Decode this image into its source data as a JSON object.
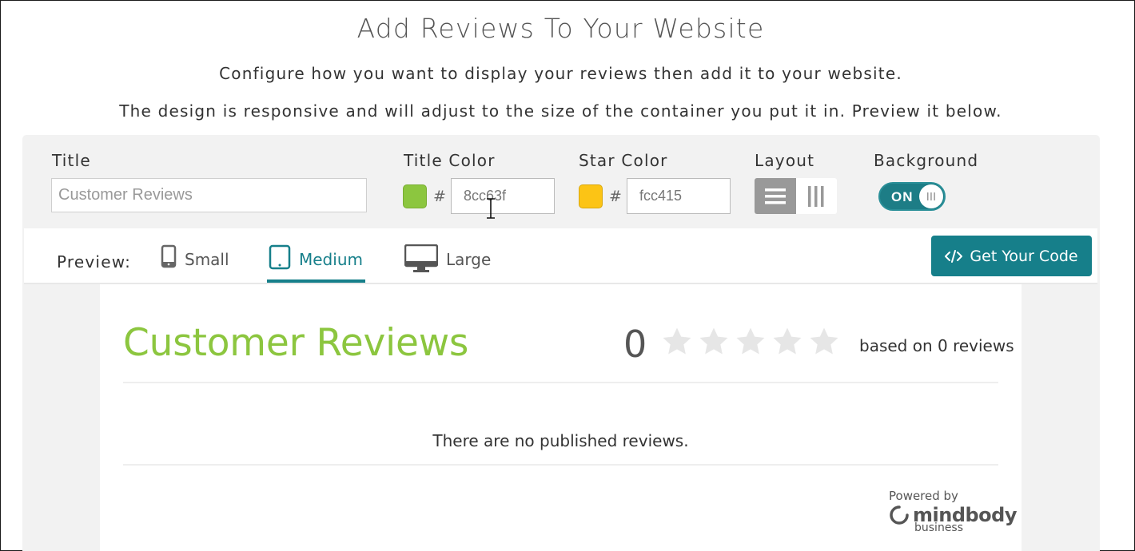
{
  "header": {
    "title": "Add Reviews To Your Website",
    "subtitle_1": "Configure how you want to display your reviews then add it to your website.",
    "subtitle_2": "The design is responsive and will adjust to the size of the container you put it in. Preview it below."
  },
  "config": {
    "title_label": "Title",
    "title_placeholder": "Customer Reviews",
    "title_color_label": "Title Color",
    "title_color_hash": "#",
    "title_color_value": "8cc63f",
    "star_color_label": "Star Color",
    "star_color_hash": "#",
    "star_color_value": "fcc415",
    "layout_label": "Layout",
    "layout_options": [
      "list-icon",
      "columns-icon"
    ],
    "layout_selected": "list-icon",
    "background_label": "Background",
    "background_toggle": "ON"
  },
  "preview": {
    "label": "Preview:",
    "tabs": [
      {
        "label": "Small",
        "icon": "phone-icon"
      },
      {
        "label": "Medium",
        "icon": "tablet-icon"
      },
      {
        "label": "Large",
        "icon": "desktop-icon"
      }
    ],
    "active_tab": "Medium",
    "code_button": "Get Your Code"
  },
  "widget": {
    "title": "Customer Reviews",
    "rating": "0",
    "star_count": 5,
    "filled_stars": 0,
    "based_on": "based on 0 reviews",
    "empty_message": "There are no published reviews.",
    "powered_by": "Powered by",
    "brand_name": "mindbody",
    "brand_sub": "business"
  },
  "colors": {
    "title_color": "#8cc63f",
    "star_color": "#fcc415",
    "accent": "#167f8a",
    "empty_star": "#e6e6e6"
  }
}
